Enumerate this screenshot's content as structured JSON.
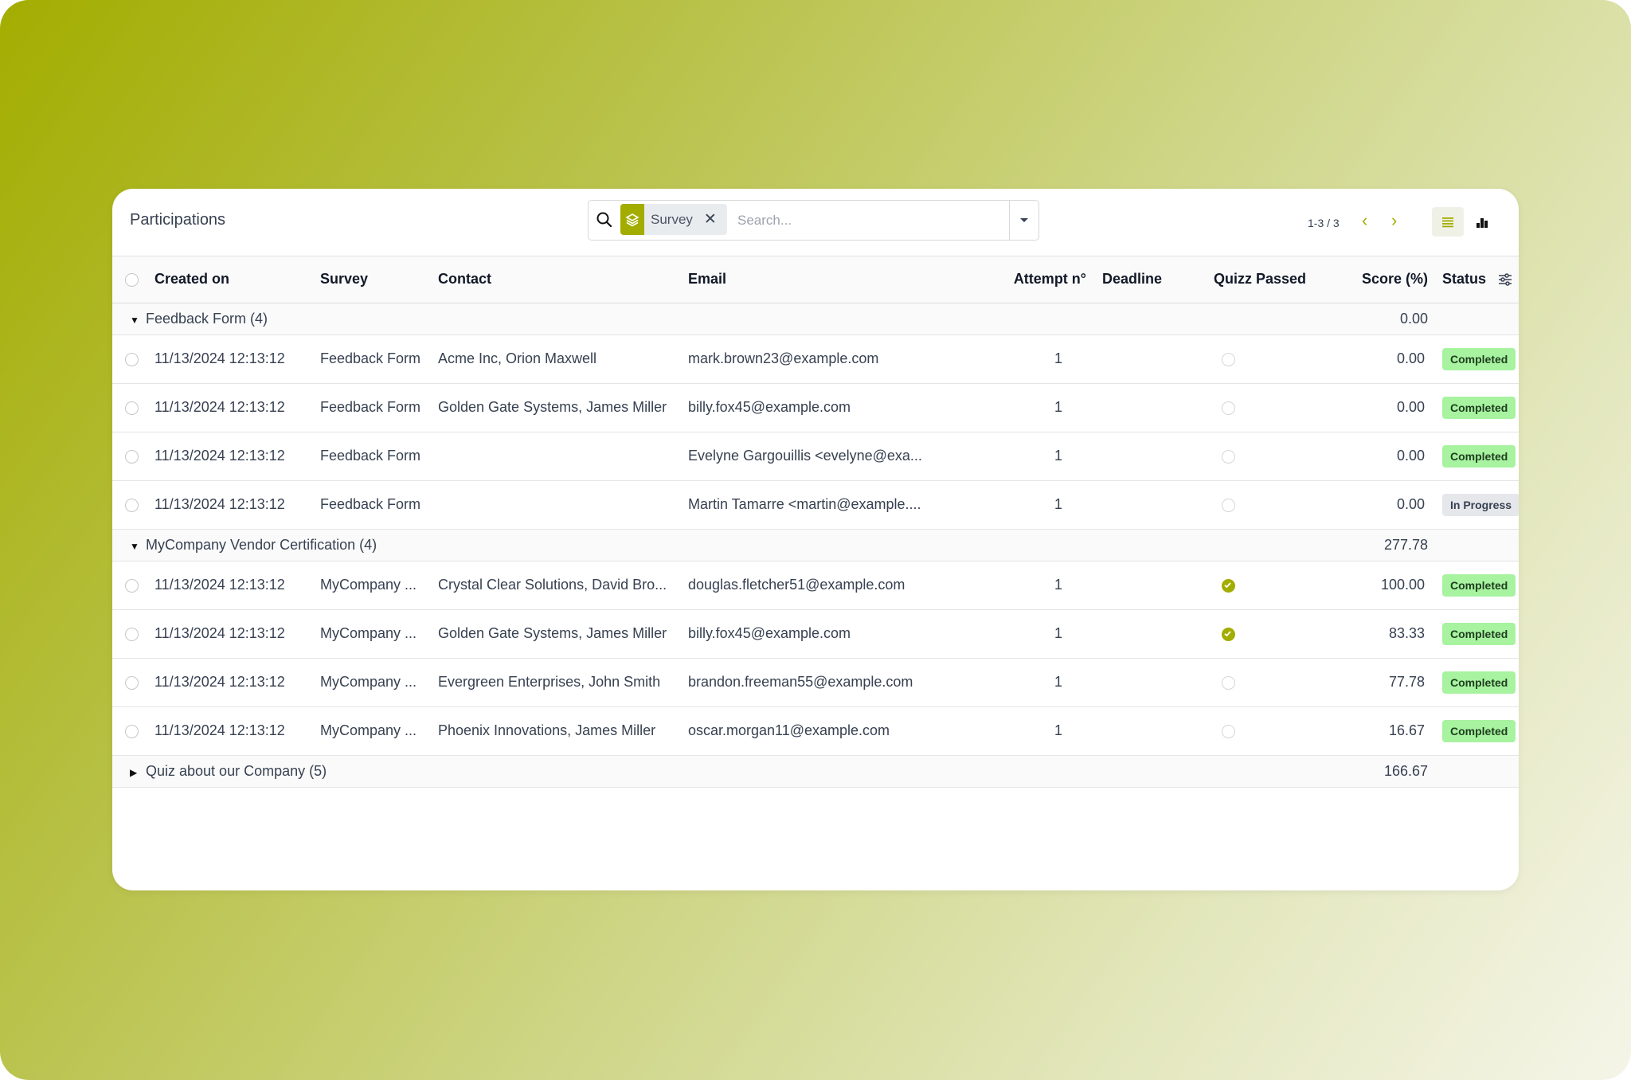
{
  "header": {
    "title": "Participations",
    "facet_label": "Survey",
    "search_placeholder": "Search...",
    "pager": "1-3 / 3"
  },
  "columns": {
    "created_on": "Created on",
    "survey": "Survey",
    "contact": "Contact",
    "email": "Email",
    "attempt": "Attempt n°",
    "deadline": "Deadline",
    "quizz_passed": "Quizz Passed",
    "score": "Score (%)",
    "status": "Status"
  },
  "groups": [
    {
      "label": "Feedback Form (4)",
      "total": "0.00",
      "rows": [
        {
          "created": "11/13/2024 12:13:12",
          "survey": "Feedback Form",
          "contact": "Acme Inc, Orion Maxwell",
          "email": "mark.brown23@example.com",
          "attempt": "1",
          "deadline": "",
          "score": "0.00",
          "status": "Completed"
        },
        {
          "created": "11/13/2024 12:13:12",
          "survey": "Feedback Form",
          "contact": "Golden Gate Systems, James Miller",
          "email": "billy.fox45@example.com",
          "attempt": "1",
          "deadline": "",
          "score": "0.00",
          "status": "Completed"
        },
        {
          "created": "11/13/2024 12:13:12",
          "survey": "Feedback Form",
          "contact": "",
          "email": "Evelyne Gargouillis <evelyne@exa...",
          "attempt": "1",
          "deadline": "",
          "score": "0.00",
          "status": "Completed"
        },
        {
          "created": "11/13/2024 12:13:12",
          "survey": "Feedback Form",
          "contact": "",
          "email": "Martin Tamarre <martin@example....",
          "attempt": "1",
          "deadline": "",
          "score": "0.00",
          "status": "In Progress"
        }
      ]
    },
    {
      "label": "MyCompany Vendor Certification (4)",
      "total": "277.78",
      "rows": [
        {
          "created": "11/13/2024 12:13:12",
          "survey": "MyCompany ...",
          "contact": "Crystal Clear Solutions, David Bro...",
          "email": "douglas.fletcher51@example.com",
          "attempt": "1",
          "deadline": "",
          "score": "100.00",
          "status": "Completed"
        },
        {
          "created": "11/13/2024 12:13:12",
          "survey": "MyCompany ...",
          "contact": "Golden Gate Systems, James Miller",
          "email": "billy.fox45@example.com",
          "attempt": "1",
          "deadline": "",
          "score": "83.33",
          "status": "Completed"
        },
        {
          "created": "11/13/2024 12:13:12",
          "survey": "MyCompany ...",
          "contact": "Evergreen Enterprises, John Smith",
          "email": "brandon.freeman55@example.com",
          "attempt": "1",
          "deadline": "",
          "score": "77.78",
          "status": "Completed"
        },
        {
          "created": "11/13/2024 12:13:12",
          "survey": "MyCompany ...",
          "contact": "Phoenix Innovations, James Miller",
          "email": "oscar.morgan11@example.com",
          "attempt": "1",
          "deadline": "",
          "score": "16.67",
          "status": "Completed"
        }
      ]
    },
    {
      "label": "Quiz about our Company (5)",
      "total": "166.67",
      "rows": []
    }
  ],
  "colors": {
    "accent": "#a3ad00",
    "badge_completed": "#a7f3a0",
    "badge_in_progress": "#e5e7eb"
  }
}
